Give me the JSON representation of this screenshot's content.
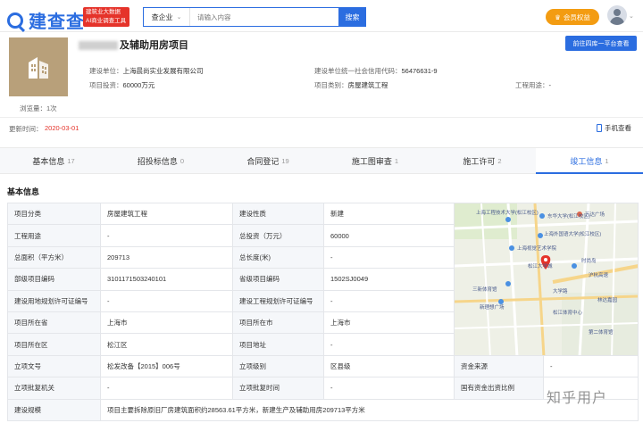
{
  "header": {
    "logo_text": "建查查",
    "badge_line1": "建筑业大数据",
    "badge_line2": "AI商业调查工具",
    "search_scope": "查企业",
    "search_placeholder": "请输入内容",
    "search_button": "搜索",
    "vip_button": "会员权益"
  },
  "project": {
    "title_suffix": "及辅助用房项目",
    "goto_button": "前往四库一平台查看",
    "browse_label": "浏览量：1次",
    "meta": {
      "builder_label": "建设单位：",
      "builder_value": "上海晨尚实业发展有限公司",
      "credit_label": "建设单位统一社会信用代码：",
      "credit_value": "56476631-9",
      "investment_label": "项目投资：",
      "investment_value": "60000万元",
      "category_label": "项目类别：",
      "category_value": "房屋建筑工程",
      "usage_label": "工程用途：",
      "usage_value": "-"
    },
    "update_label": "更新时间：",
    "update_value": "2020-03-01",
    "mobile_link": "手机查看"
  },
  "tabs": [
    {
      "label": "基本信息",
      "count": "17"
    },
    {
      "label": "招投标信息",
      "count": "0"
    },
    {
      "label": "合同登记",
      "count": "19"
    },
    {
      "label": "施工图审查",
      "count": "1"
    },
    {
      "label": "施工许可",
      "count": "2"
    },
    {
      "label": "竣工信息",
      "count": "1"
    }
  ],
  "section_title": "基本信息",
  "table": {
    "r1": {
      "l1": "项目分类",
      "v1": "房屋建筑工程",
      "l2": "建设性质",
      "v2": "新建"
    },
    "r2": {
      "l1": "工程用途",
      "v1": "-",
      "l2": "总投资（万元）",
      "v2": "60000"
    },
    "r3": {
      "l1": "总面积（平方米）",
      "v1": "209713",
      "l2": "总长度(米)",
      "v2": "-"
    },
    "r4": {
      "l1": "部级项目编码",
      "v1": "3101171503240101",
      "l2": "省级项目编码",
      "v2": "1502SJ0049"
    },
    "r5": {
      "l1": "建设用地规划许可证编号",
      "v1": "-",
      "l2": "建设工程规划许可证编号",
      "v2": "-"
    },
    "r6": {
      "l1": "项目所在省",
      "v1": "上海市",
      "l2": "项目所在市",
      "v2": "上海市"
    },
    "r7": {
      "l1": "项目所在区",
      "v1": "松江区",
      "l2": "项目地址",
      "v2": "-"
    },
    "r8": {
      "l1": "立项文号",
      "v1": "松发改备【2015】006号",
      "l2": "立项级别",
      "v2": "区县级",
      "l3": "资金来源",
      "v3": "-"
    },
    "r9": {
      "l1": "立项批复机关",
      "v1": "-",
      "l2": "立项批复时间",
      "v2": "-",
      "l3": "国有资金出资比例",
      "v3": ""
    },
    "r10": {
      "l1": "建设规模",
      "v1": "项目主要拆除原旧厂房建筑面积约28563.61平方米，新建生产及辅助用房209713平方米"
    }
  },
  "map": {
    "labels": [
      "上海工程技术大学(松江校区)",
      "东华大学(松江校区)",
      "万达广场",
      "上海外国语大学(松江校区)",
      "上海视觉艺术学院",
      "松江大学城",
      "时尚岛",
      "沪杭高速",
      "松江体育中心",
      "三新体育馆",
      "新理想广场",
      "林达嘉园",
      "大学路",
      "第二体育馆"
    ]
  },
  "watermark": "知乎用户"
}
